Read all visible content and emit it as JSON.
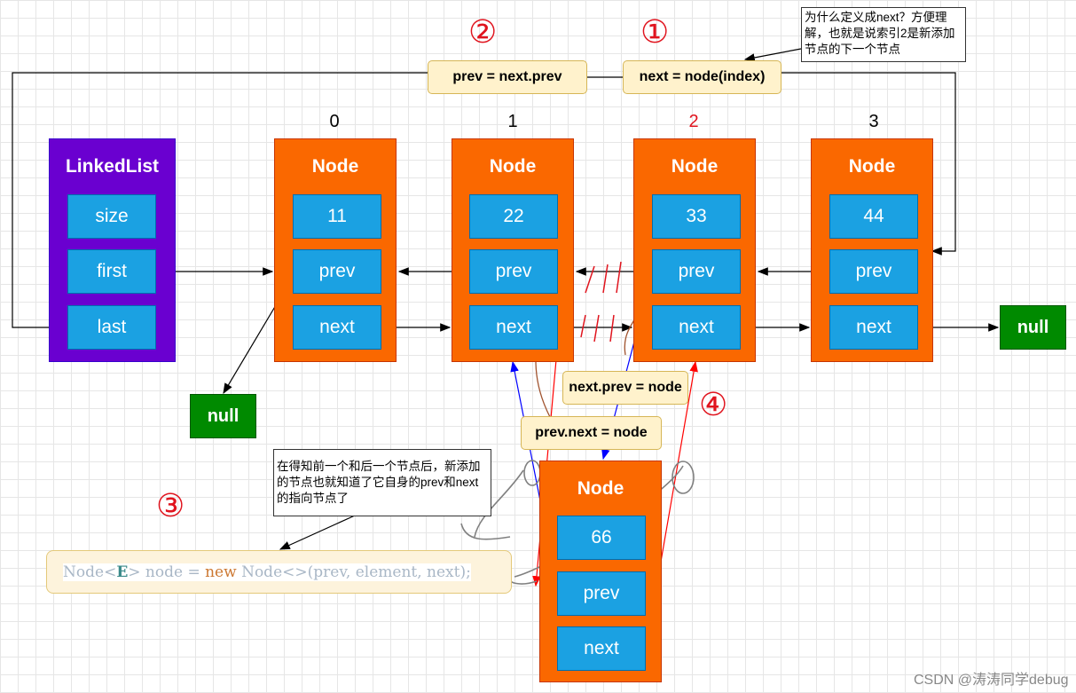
{
  "linkedlist": {
    "title": "LinkedList",
    "fields": [
      "size",
      "first",
      "last"
    ],
    "color": "#6a00d0"
  },
  "indices": [
    "0",
    "1",
    "2",
    "3"
  ],
  "nodes": [
    {
      "title": "Node",
      "value": "11",
      "prev": "prev",
      "next": "next"
    },
    {
      "title": "Node",
      "value": "22",
      "prev": "prev",
      "next": "next"
    },
    {
      "title": "Node",
      "value": "33",
      "prev": "prev",
      "next": "next"
    },
    {
      "title": "Node",
      "value": "44",
      "prev": "prev",
      "next": "next"
    }
  ],
  "new_node": {
    "title": "Node",
    "value": "66",
    "prev": "prev",
    "next": "next"
  },
  "null_label": "null",
  "labels": {
    "prev_assign": "prev = next.prev",
    "next_assign": "next = node(index)",
    "next_prev": "next.prev = node",
    "prev_next": "prev.next = node"
  },
  "notes": {
    "top": "为什么定义成next？方便理解，也就是说索引2是新添加节点的下一个节点",
    "left": "在得知前一个和后一个节点后，新添加的节点也就知道了它自身的prev和next的指向节点了"
  },
  "code": {
    "p1": "Node",
    "p2": "<",
    "p3": "E",
    "p4": "> node = ",
    "kw": "new",
    "p5": " Node<>(prev, element, next);"
  },
  "steps": [
    "②",
    "①",
    "③",
    "④"
  ],
  "watermark": "CSDN @涛涛同学debug",
  "colors": {
    "node": "#fa6800",
    "field": "#1ba1e2",
    "null": "#008a00",
    "step": "#e0141e"
  }
}
